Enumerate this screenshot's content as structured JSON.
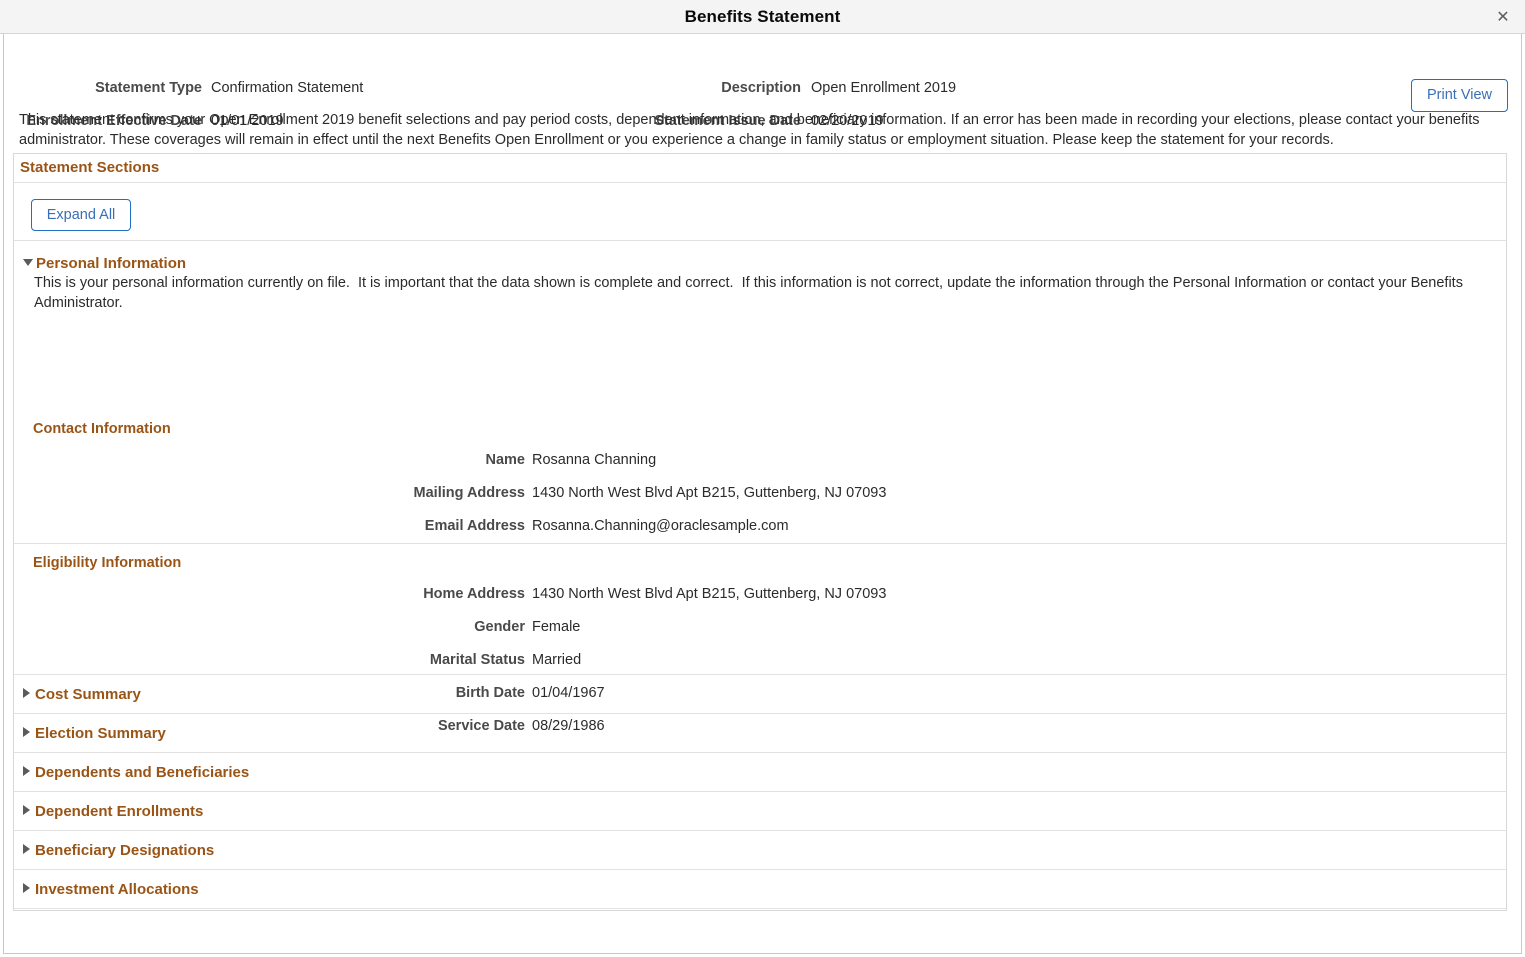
{
  "window": {
    "title": "Benefits Statement",
    "close_icon": "close-icon"
  },
  "header": {
    "fields": [
      {
        "label": "Statement Type",
        "value": "Confirmation Statement"
      },
      {
        "label": "Enrollment Effective Date",
        "value": "01/01/2019"
      },
      {
        "label": "Description",
        "value": "Open Enrollment 2019"
      },
      {
        "label": "Statement Issue Date",
        "value": "02/20/2019"
      }
    ],
    "print_view_label": "Print View"
  },
  "intro_text": "This statement confirms your Open Enrollment 2019 benefit selections and pay period costs, dependent information, and beneficiary information. If an error has been made in recording your elections, please contact your benefits administrator. These coverages will remain in effect until the next Benefits Open Enrollment or you experience a change in family status or employment situation. Please keep the statement for your records.",
  "sections_panel": {
    "title": "Statement Sections",
    "expand_all_label": "Expand All"
  },
  "personal_information": {
    "title": "Personal Information",
    "expanded": true,
    "toggle_icon": "triangle-down-icon",
    "description": "This is your personal information currently on file.  It is important that the data shown is complete and correct.  If this information is not correct, update the information through the Personal Information or contact your Benefits Administrator.",
    "contact_information": {
      "heading": "Contact Information",
      "fields": [
        {
          "label": "Name",
          "value": "Rosanna Channing"
        },
        {
          "label": "Mailing Address",
          "value": "1430 North West Blvd Apt B215, Guttenberg, NJ 07093"
        },
        {
          "label": "Email Address",
          "value": "Rosanna.Channing@oraclesample.com"
        }
      ]
    },
    "eligibility_information": {
      "heading": "Eligibility Information",
      "fields": [
        {
          "label": "Home Address",
          "value": "1430 North West Blvd Apt B215, Guttenberg, NJ 07093"
        },
        {
          "label": "Gender",
          "value": "Female"
        },
        {
          "label": "Marital Status",
          "value": "Married"
        },
        {
          "label": "Birth Date",
          "value": "01/04/1967"
        },
        {
          "label": "Service Date",
          "value": "08/29/1986"
        }
      ]
    }
  },
  "collapsed_sections": [
    {
      "title": "Cost Summary",
      "toggle_icon": "triangle-right-icon"
    },
    {
      "title": "Election Summary",
      "toggle_icon": "triangle-right-icon"
    },
    {
      "title": "Dependents and Beneficiaries",
      "toggle_icon": "triangle-right-icon"
    },
    {
      "title": "Dependent Enrollments",
      "toggle_icon": "triangle-right-icon"
    },
    {
      "title": "Beneficiary Designations",
      "toggle_icon": "triangle-right-icon"
    },
    {
      "title": "Investment Allocations",
      "toggle_icon": "triangle-right-icon"
    }
  ],
  "colors": {
    "heading_brown": "#9a5516",
    "link_blue": "#3a6fb5",
    "border_blue": "#1f6fc4",
    "label_gray": "#4a4a4a",
    "titlebar_bg": "#f4f4f4"
  }
}
